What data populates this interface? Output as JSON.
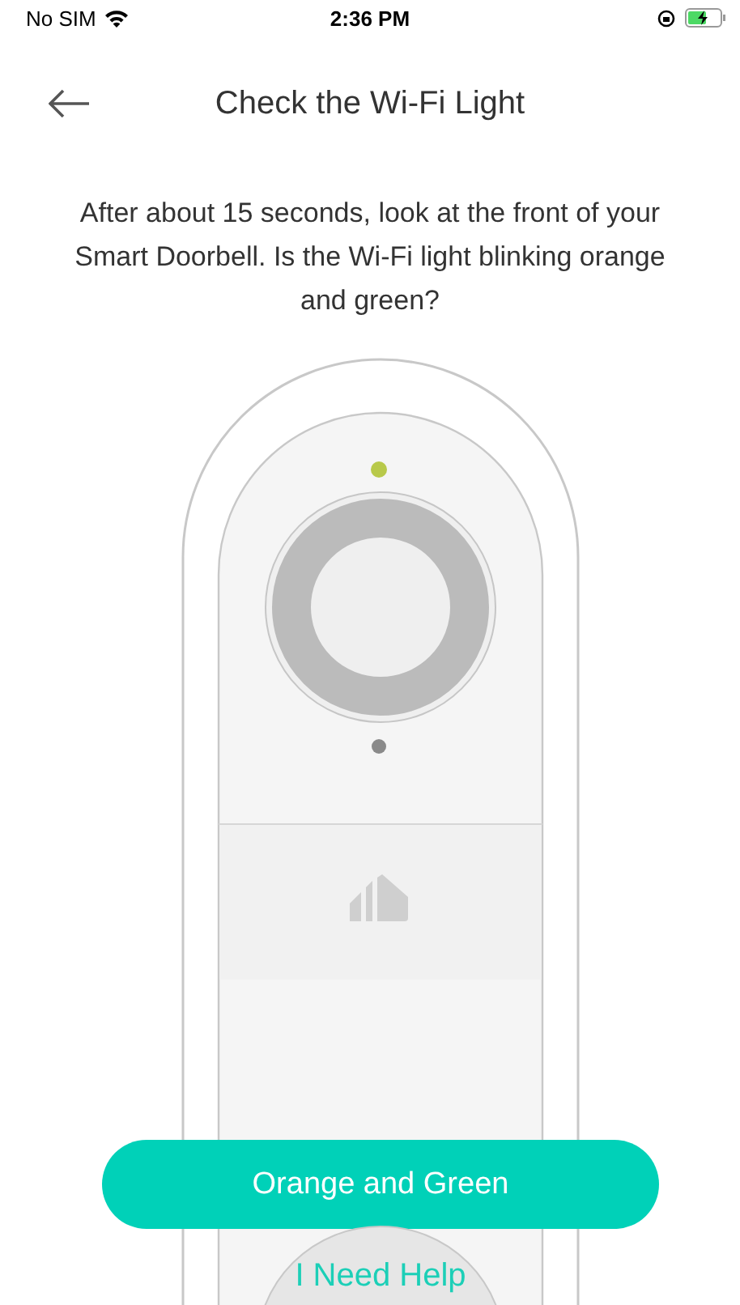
{
  "status_bar": {
    "carrier": "No SIM",
    "time": "2:36 PM"
  },
  "header": {
    "title": "Check the Wi-Fi Light"
  },
  "instruction": "After about 15 seconds, look at the front of your Smart Doorbell. Is the Wi-Fi light blinking orange and green?",
  "actions": [
    {
      "kind": "primary",
      "label": "Orange and Green"
    },
    {
      "kind": "help",
      "label": "I Need Help"
    }
  ]
}
